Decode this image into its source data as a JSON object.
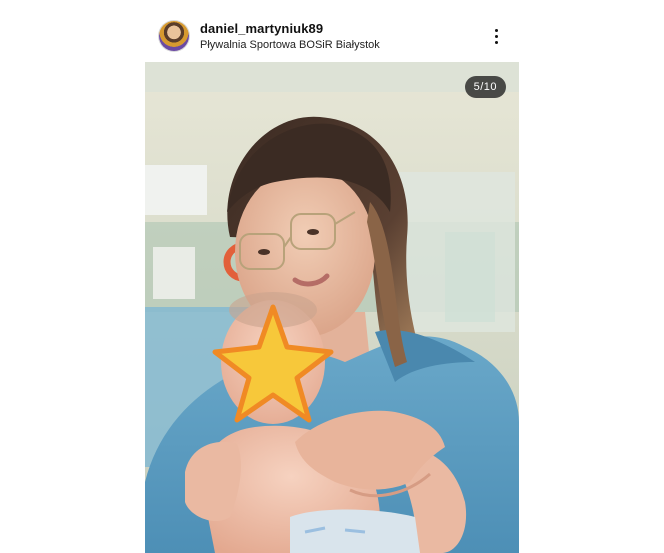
{
  "post": {
    "username": "daniel_martyniuk89",
    "location": "Pływalnia Sportowa BOSiR Białystok",
    "image_counter": "5/10",
    "avatar_icon": "profile-avatar",
    "more_icon": "more-vertical-icon"
  },
  "colors": {
    "hoodie": "#5a9bc0",
    "pool_wall": "#e6e8d8",
    "star": "#f7c83a",
    "star_outline": "#f08a24"
  }
}
